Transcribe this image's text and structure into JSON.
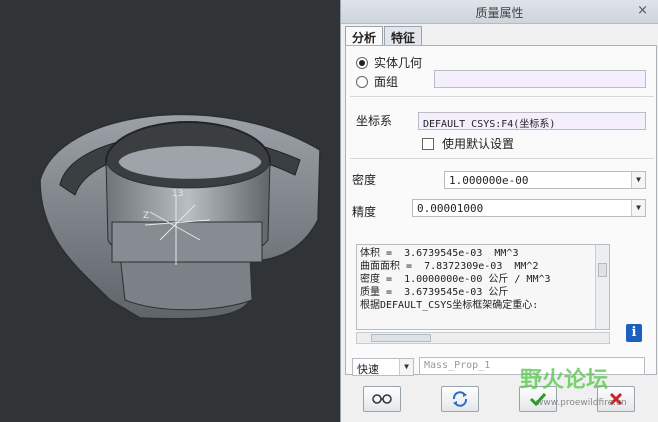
{
  "dialog": {
    "title": "质量属性",
    "close_glyph": "×",
    "tabs": [
      {
        "label": "分析",
        "active": true
      },
      {
        "label": "特征",
        "active": false
      }
    ],
    "geometry_options": [
      {
        "label": "实体几何",
        "selected": true
      },
      {
        "label": "面组",
        "selected": false
      }
    ],
    "surface_field_value": "",
    "csys": {
      "label": "坐标系",
      "value": "DEFAULT_CSYS:F4(坐标系)",
      "use_default_label": "使用默认设置",
      "use_default_checked": false
    },
    "density": {
      "label": "密度",
      "value": "1.000000e-00"
    },
    "precision": {
      "label": "精度",
      "value": "0.00001000"
    },
    "results": [
      "体积 =  3.6739545e-03  MM^3",
      "曲面面积 =  7.8372309e-03  MM^2",
      "密度 =  1.0000000e-00 公斤 / MM^3",
      "质量 =  3.6739545e-03 公斤",
      "",
      "根据DEFAULT_CSYS坐标框架确定重心:"
    ],
    "info_glyph": "i",
    "mode": {
      "value": "快速",
      "name_placeholder": "Mass_Prop_1"
    },
    "buttons": {
      "preview_icon": "glasses-icon",
      "repeat_icon": "refresh-icon",
      "ok_icon": "checkmark-icon",
      "cancel_icon": "cancel-x-icon"
    },
    "accent": "#1b5fbf",
    "ok_color": "#2a9a2a",
    "cancel_color": "#cc2222"
  },
  "watermark": {
    "brand": "野火论坛",
    "url": "www.proewildfire.cn"
  }
}
